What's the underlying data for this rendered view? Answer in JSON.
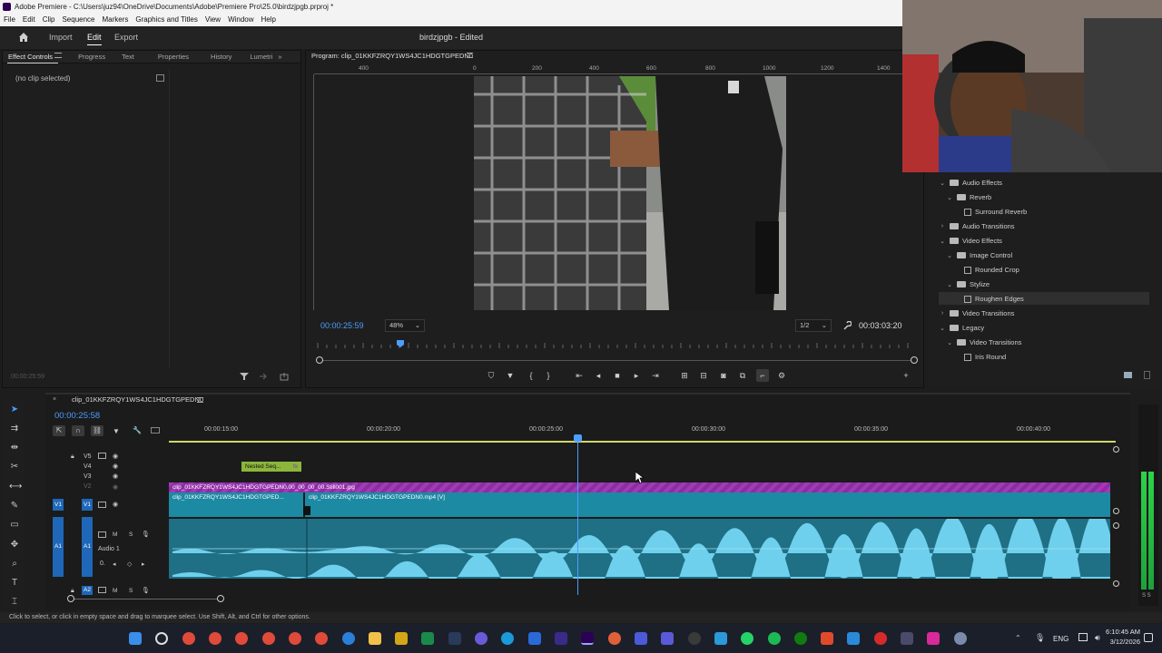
{
  "window": {
    "title": "Adobe Premiere - C:\\Users\\juz94\\OneDrive\\Documents\\Adobe\\Premiere Pro\\25.0\\birdzjpgb.prproj *",
    "menu": [
      "File",
      "Edit",
      "Clip",
      "Sequence",
      "Markers",
      "Graphics and Titles",
      "View",
      "Window",
      "Help"
    ]
  },
  "header": {
    "nav": [
      "Import",
      "Edit",
      "Export"
    ],
    "active_nav": "Edit",
    "project_title": "birdzjpgb",
    "project_status": "- Edited"
  },
  "left_panel": {
    "tabs": [
      "Effect Controls",
      "Progress",
      "Text",
      "Properties",
      "History",
      "Lumetri"
    ],
    "active_tab": "Effect Controls",
    "no_clip_text": "(no clip selected)",
    "bottom_timecode": "00:00:25:59"
  },
  "program_monitor": {
    "title": "Program: clip_01KKFZRQY1WS4JC1HDGTGPEDN0",
    "ruler_labels": [
      "400",
      "0",
      "200",
      "400",
      "600",
      "800",
      "1000",
      "1200",
      "1400"
    ],
    "current_timecode": "00:00:25:59",
    "zoom": "48%",
    "resolution": "1/2",
    "duration": "00:03:03:20"
  },
  "effects_panel": {
    "items": [
      {
        "label": "Audio Effects",
        "level": 0,
        "expanded": true,
        "type": "folder"
      },
      {
        "label": "Reverb",
        "level": 1,
        "expanded": true,
        "type": "folder"
      },
      {
        "label": "Surround Reverb",
        "level": 2,
        "type": "effect"
      },
      {
        "label": "Audio Transitions",
        "level": 0,
        "expanded": false,
        "type": "folder"
      },
      {
        "label": "Video Effects",
        "level": 0,
        "expanded": true,
        "type": "folder"
      },
      {
        "label": "Image Control",
        "level": 1,
        "expanded": true,
        "type": "folder"
      },
      {
        "label": "Rounded Crop",
        "level": 2,
        "type": "effect"
      },
      {
        "label": "Stylize",
        "level": 1,
        "expanded": true,
        "type": "folder"
      },
      {
        "label": "Roughen Edges",
        "level": 2,
        "type": "effect",
        "selected": true
      },
      {
        "label": "Video Transitions",
        "level": 0,
        "expanded": false,
        "type": "folder"
      },
      {
        "label": "Legacy",
        "level": 0,
        "expanded": true,
        "type": "folder"
      },
      {
        "label": "Video Transitions",
        "level": 1,
        "expanded": true,
        "type": "folder"
      },
      {
        "label": "Iris Round",
        "level": 2,
        "type": "effect"
      }
    ]
  },
  "timeline": {
    "sequence_name": "clip_01KKFZRQY1WS4JC1HDGTGPEDN0",
    "timecode": "00:00:25:58",
    "ruler_labels": [
      "00:00:15:00",
      "00:00:20:00",
      "00:00:25:00",
      "00:00:30:00",
      "00:00:35:00",
      "00:00:40:00"
    ],
    "tracks": {
      "v5": "V5",
      "v4": "V4",
      "v3": "V3",
      "v2": "V2",
      "v1": "V1",
      "v1_src": "V1",
      "a1": "A1",
      "a1_src": "A1",
      "a1_name": "Audio 1",
      "a2": "A2",
      "a2_name": "A2"
    },
    "clips": {
      "nested": "Nested Seq...",
      "image_clip": "clip_01KKFZRQY1WS4JC1HDGTGPEDN0.00_00_00_00.Still001.jpg",
      "video_clip_1": "clip_01KKFZRQY1WS4JC1HDGTGPED...",
      "video_clip_2": "clip_01KKFZRQY1WS4JC1HDGTGPEDN0.mp4 [V]"
    }
  },
  "status": {
    "text": "Click to select, or click in empty space and drag to marquee select. Use Shift, Alt, and Ctrl for other options."
  },
  "taskbar": {
    "lang": "ENG",
    "time": "6:10:45 AM",
    "date": "3/12/2026"
  },
  "colors": {
    "accent": "#4a9eff",
    "clip_video": "#1c8aa3",
    "clip_image": "#a03bb8",
    "clip_nested": "#8bb63b",
    "clip_audio": "#1f6f85"
  }
}
